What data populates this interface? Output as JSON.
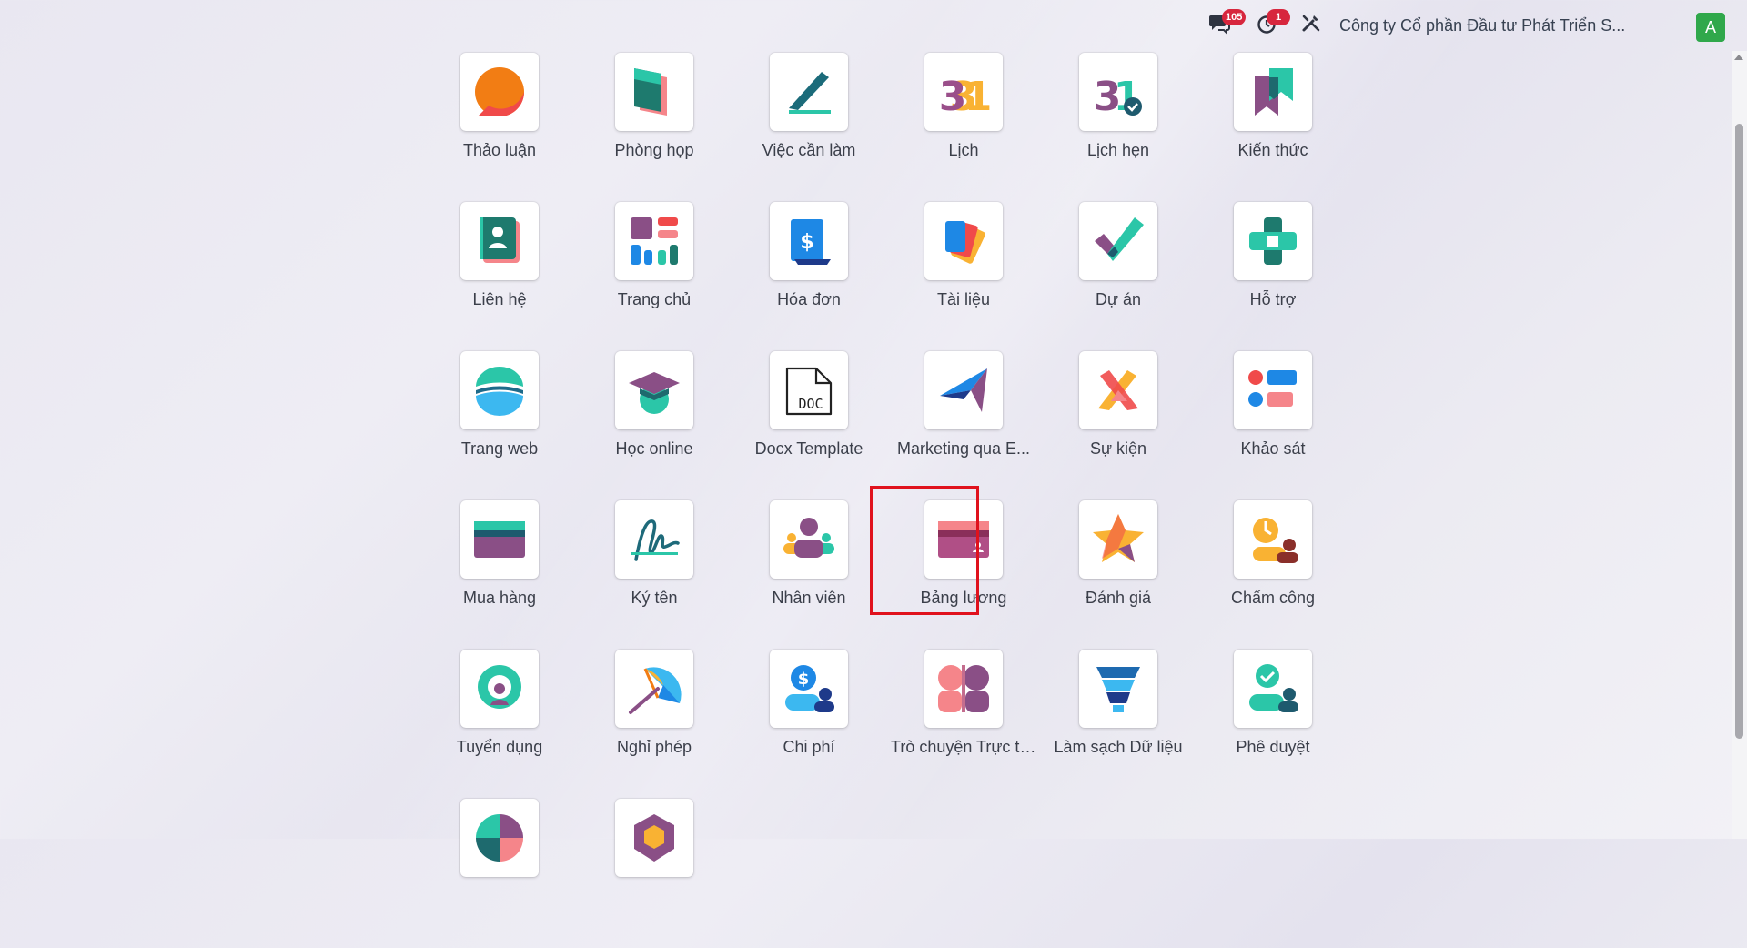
{
  "topbar": {
    "messages_badge": "105",
    "activities_badge": "1",
    "company": "Công ty Cổ phần Đầu tư Phát Triển S...",
    "avatar_letter": "A",
    "icons": [
      "chat-icon",
      "clock-icon",
      "tools-icon"
    ]
  },
  "apps": [
    {
      "label": "Thảo luận",
      "icon": "discuss-icon"
    },
    {
      "label": "Phòng họp",
      "icon": "meeting-room-icon"
    },
    {
      "label": "Việc cần làm",
      "icon": "todo-icon"
    },
    {
      "label": "Lịch",
      "icon": "calendar-icon"
    },
    {
      "label": "Lịch hẹn",
      "icon": "appointment-icon"
    },
    {
      "label": "Kiến thức",
      "icon": "knowledge-icon"
    },
    {
      "label": "Liên hệ",
      "icon": "contacts-icon"
    },
    {
      "label": "Trang chủ",
      "icon": "dashboard-icon"
    },
    {
      "label": "Hóa đơn",
      "icon": "invoice-icon"
    },
    {
      "label": "Tài liệu",
      "icon": "documents-icon"
    },
    {
      "label": "Dự án",
      "icon": "project-icon"
    },
    {
      "label": "Hỗ trợ",
      "icon": "helpdesk-icon"
    },
    {
      "label": "Trang web",
      "icon": "website-icon"
    },
    {
      "label": "Học online",
      "icon": "elearning-icon"
    },
    {
      "label": "Docx Template",
      "icon": "docx-icon",
      "icon_text": "DOC"
    },
    {
      "label": "Marketing qua E...",
      "icon": "email-marketing-icon"
    },
    {
      "label": "Sự kiện",
      "icon": "events-icon"
    },
    {
      "label": "Khảo sát",
      "icon": "survey-icon"
    },
    {
      "label": "Mua hàng",
      "icon": "purchase-icon"
    },
    {
      "label": "Ký tên",
      "icon": "sign-icon"
    },
    {
      "label": "Nhân viên",
      "icon": "employees-icon"
    },
    {
      "label": "Bảng lương",
      "icon": "payroll-icon",
      "highlighted": true
    },
    {
      "label": "Đánh giá",
      "icon": "appraisal-icon"
    },
    {
      "label": "Chấm công",
      "icon": "attendance-icon"
    },
    {
      "label": "Tuyển dụng",
      "icon": "recruitment-icon"
    },
    {
      "label": "Nghỉ phép",
      "icon": "time-off-icon"
    },
    {
      "label": "Chi phí",
      "icon": "expenses-icon"
    },
    {
      "label": "Trò chuyện Trực ti...",
      "icon": "live-chat-icon"
    },
    {
      "label": "Làm sạch Dữ liệu",
      "icon": "data-cleaning-icon"
    },
    {
      "label": "Phê duyệt",
      "icon": "approvals-icon"
    },
    {
      "label": "",
      "icon": "reporting-icon"
    },
    {
      "label": "",
      "icon": "app-icon"
    }
  ],
  "colors": {
    "highlight": "#e0121d",
    "avatar": "#30a84b",
    "badge": "#d7263d"
  }
}
